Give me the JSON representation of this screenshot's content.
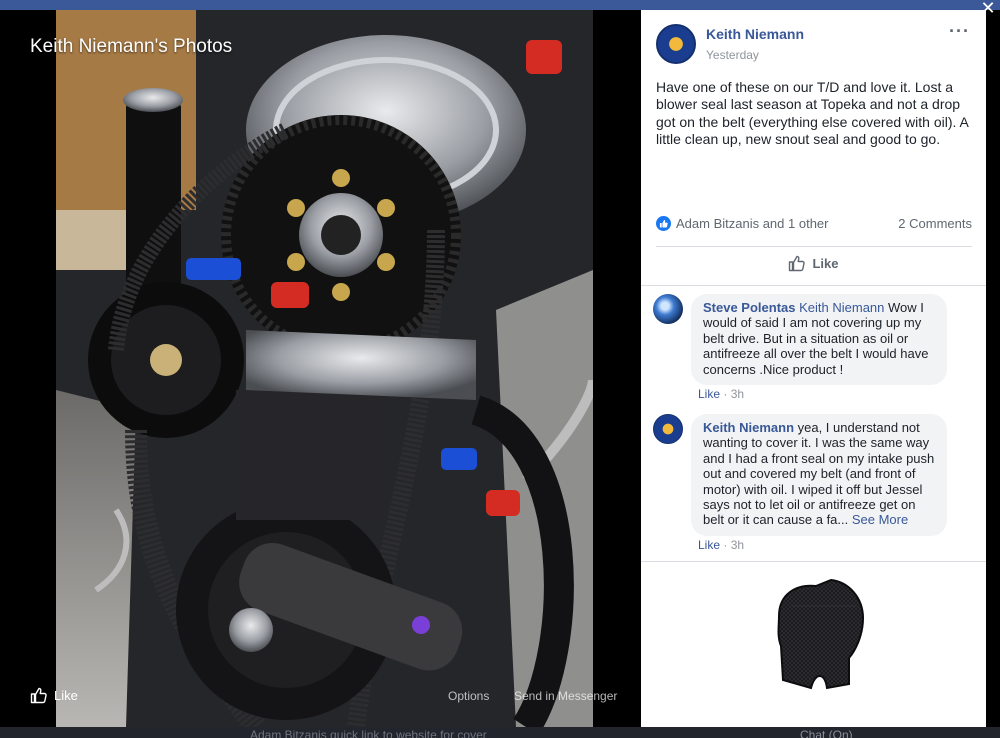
{
  "viewer": {
    "title": "Keith Niemann's Photos",
    "like_label": "Like",
    "options_label": "Options",
    "send_label": "Send in Messenger",
    "close_symbol": "✕"
  },
  "post": {
    "author": "Keith Niemann",
    "time": "Yesterday",
    "text": "Have one of these on our T/D and love it. Lost a blower seal last season at Topeka and not a drop got on the belt (everything else covered with oil). A little clean up, new snout seal and good to go.",
    "reactions_text": "Adam Bitzanis and 1 other",
    "comments_count": "2 Comments",
    "like_action": "Like",
    "more_icon": "more-dots-icon"
  },
  "comments": [
    {
      "author": "Steve Polentas",
      "mention": "Keith Niemann",
      "text": " Wow I would of said I am not covering up my belt drive. But in a situation as oil or antifreeze all over the belt I would have concerns .Nice product !",
      "like_label": "Like",
      "separator": " · ",
      "time": "3h"
    },
    {
      "author": "Keith Niemann",
      "text": " yea, I understand not wanting to cover it. I was the same way and I had a front seal on my intake push out and covered my belt (and front of motor) with oil. I wiped it off but Jessel says not to let oil or antifreeze get on belt or it can cause a fa...",
      "see_more": " See More",
      "like_label": "Like",
      "separator": " · ",
      "time": "3h"
    }
  ],
  "background": {
    "post_text": "Adam Bitzanis quick link to website for cover",
    "chat_text": "Chat (On)"
  },
  "colors": {
    "facebook_blue": "#385898",
    "like_blue": "#1877f2",
    "bubble_gray": "#f2f3f5"
  }
}
